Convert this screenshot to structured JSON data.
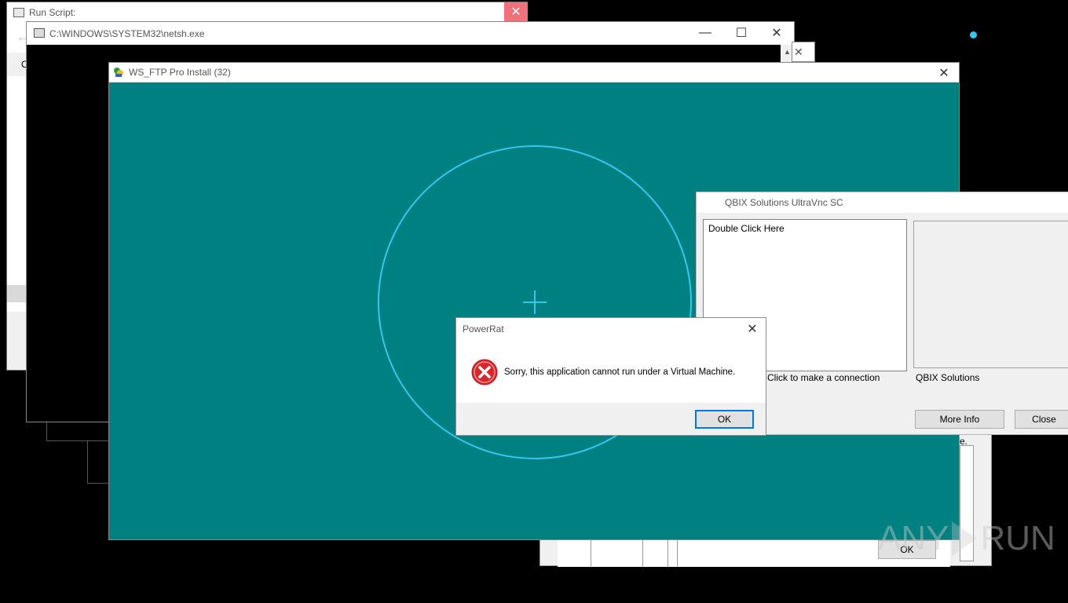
{
  "run_script": {
    "title": "Run Script:",
    "fragment": "O"
  },
  "netsh": {
    "title": "C:\\WINDOWS\\SYSTEM32\\netsh.exe"
  },
  "wsftp": {
    "title": "WS_FTP Pro Install (32)"
  },
  "ultravnc": {
    "title": "QBIX Solutions UltraVnc SC",
    "list_item": "Double Click Here",
    "hint": "e Click to make a connection",
    "company": "QBIX Solutions",
    "more_info": "More Info",
    "close": "Close"
  },
  "back_dialog": {
    "ok": "OK",
    "fragment": "e."
  },
  "powerrat": {
    "title": "PowerRat",
    "message": "Sorry, this application cannot run under a Virtual Machine.",
    "ok": "OK"
  },
  "watermark": {
    "text_left": "ANY",
    "text_right": "RUN"
  },
  "colors": {
    "teal": "#008080",
    "accent_cyan": "#32c8f0",
    "error_red": "#d9262b"
  }
}
